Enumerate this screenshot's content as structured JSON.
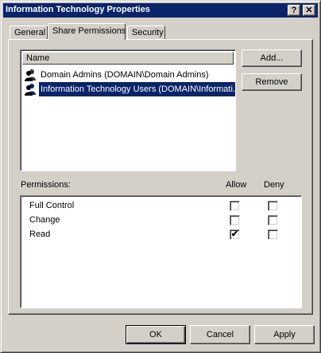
{
  "window": {
    "title": "Information Technology Properties",
    "help_button": "?",
    "close_button": "✕"
  },
  "tabs": [
    {
      "label": "General",
      "active": false
    },
    {
      "label": "Share Permissions",
      "active": true
    },
    {
      "label": "Security",
      "active": false
    }
  ],
  "names_list": {
    "column_header": "Name",
    "rows": [
      {
        "label": "Domain Admins (DOMAIN\\Domain Admins)",
        "icon": "user-group-icon",
        "selected": false
      },
      {
        "label": "Information Technology Users (DOMAIN\\Informati...",
        "icon": "user-group-icon",
        "selected": true
      }
    ]
  },
  "buttons": {
    "add": "Add...",
    "remove": "Remove",
    "ok": "OK",
    "cancel": "Cancel",
    "apply": "Apply"
  },
  "permissions": {
    "label": "Permissions:",
    "allow_header": "Allow",
    "deny_header": "Deny",
    "rows": [
      {
        "name": "Full Control",
        "allow": false,
        "deny": false
      },
      {
        "name": "Change",
        "allow": false,
        "deny": false
      },
      {
        "name": "Read",
        "allow": true,
        "deny": false
      }
    ]
  },
  "colors": {
    "titlebar": "#0a246a",
    "face": "#d4d0c8",
    "selection": "#0a246a"
  }
}
